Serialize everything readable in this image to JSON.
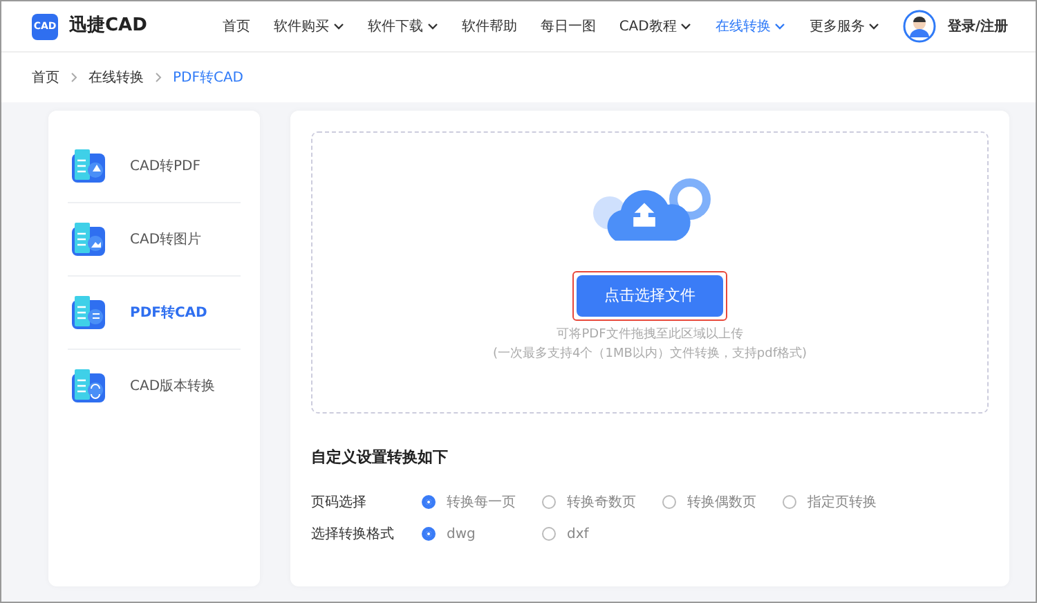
{
  "header": {
    "logo_badge": "CAD",
    "brand": "迅捷CAD",
    "nav": [
      {
        "label": "首页",
        "dropdown": false,
        "selected": false
      },
      {
        "label": "软件购买",
        "dropdown": true,
        "selected": false
      },
      {
        "label": "软件下载",
        "dropdown": true,
        "selected": false
      },
      {
        "label": "软件帮助",
        "dropdown": false,
        "selected": false
      },
      {
        "label": "每日一图",
        "dropdown": false,
        "selected": false
      },
      {
        "label": "CAD教程",
        "dropdown": true,
        "selected": false
      },
      {
        "label": "在线转换",
        "dropdown": true,
        "selected": true
      },
      {
        "label": "更多服务",
        "dropdown": true,
        "selected": false
      }
    ],
    "login": "登录/注册"
  },
  "breadcrumb": [
    {
      "label": "首页",
      "current": false
    },
    {
      "label": "在线转换",
      "current": false
    },
    {
      "label": "PDF转CAD",
      "current": true
    }
  ],
  "sidebar": {
    "items": [
      {
        "label": "CAD转PDF",
        "selected": false
      },
      {
        "label": "CAD转图片",
        "selected": false
      },
      {
        "label": "PDF转CAD",
        "selected": true
      },
      {
        "label": "CAD版本转换",
        "selected": false
      }
    ]
  },
  "upload": {
    "button": "点击选择文件",
    "hint": "可将PDF文件拖拽至此区域以上传",
    "note": "(一次最多支持4个（1MB以内）文件转换，支持pdf格式)"
  },
  "settings": {
    "title": "自定义设置转换如下",
    "groups": [
      {
        "label": "页码选择",
        "options": [
          {
            "label": "转换每一页",
            "selected": true
          },
          {
            "label": "转换奇数页",
            "selected": false
          },
          {
            "label": "转换偶数页",
            "selected": false
          },
          {
            "label": "指定页转换",
            "selected": false
          }
        ]
      },
      {
        "label": "选择转换格式",
        "options": [
          {
            "label": "dwg",
            "selected": true
          },
          {
            "label": "dxf",
            "selected": false
          }
        ]
      }
    ]
  }
}
